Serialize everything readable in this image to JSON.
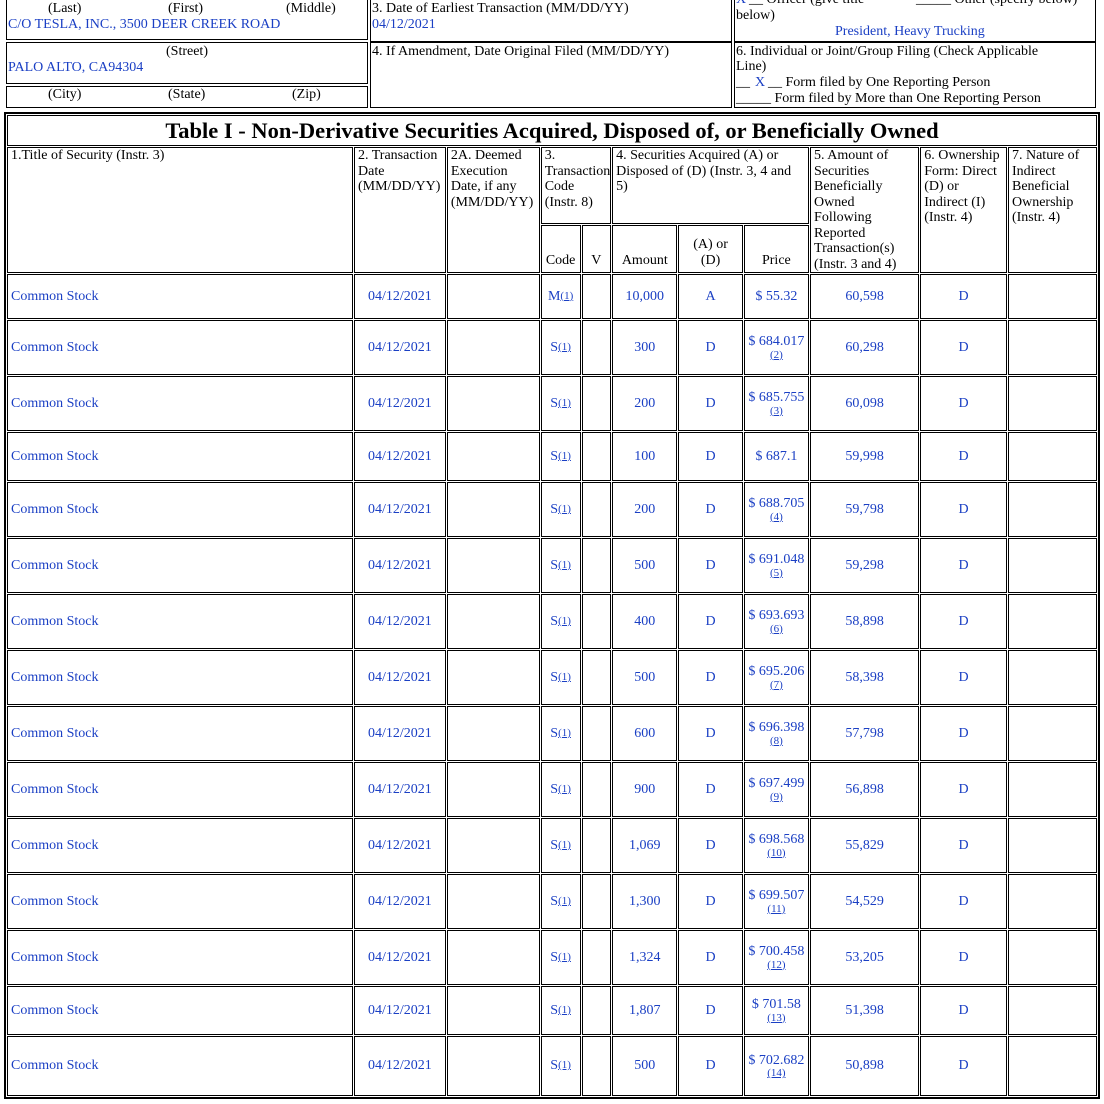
{
  "header": {
    "name_labels": {
      "last": "(Last)",
      "first": "(First)",
      "middle": "(Middle)"
    },
    "street_value": "C/O TESLA, INC., 3500 DEER CREEK ROAD",
    "street_label": "(Street)",
    "city_value": "PALO ALTO, CA94304",
    "city_label": "(City)",
    "state_label": "(State)",
    "zip_label": "(Zip)",
    "earliest_tx_label": "3. Date of Earliest Transaction (MM/DD/YY)",
    "earliest_tx_value": "04/12/2021",
    "amendment_label": "4. If Amendment, Date Original Filed (MM/DD/YY)",
    "officer_mark": "X",
    "officer_label": "__ Officer (give title",
    "officer_label2": "below)",
    "other_label": "_____ Other (specify below)",
    "officer_title": "President, Heavy Trucking",
    "filing_label": "6. Individual or Joint/Group Filing (Check Applicable",
    "filing_label2": "Line)",
    "filing_one_prefix": "__",
    "filing_one_mark": "X",
    "filing_one_text": "__ Form filed by One Reporting Person",
    "filing_more_text": "_____ Form filed by More than One Reporting Person"
  },
  "table": {
    "title": "Table I - Non-Derivative Securities Acquired, Disposed of, or Beneficially Owned",
    "columns": {
      "c1": "1.Title of Security (Instr. 3)",
      "c2": "2. Transaction Date (MM/DD/YY)",
      "c2a": "2A. Deemed Execution Date, if any (MM/DD/YY)",
      "c3": "3. Transaction Code (Instr. 8)",
      "c4": "4. Securities Acquired (A) or Disposed of (D) (Instr. 3, 4 and 5)",
      "c5": "5. Amount of Securities Beneficially Owned Following Reported Transaction(s) (Instr. 3 and 4)",
      "c6": "6. Ownership Form: Direct (D) or Indirect (I) (Instr. 4)",
      "c7": "7. Nature of Indirect Beneficial Ownership (Instr. 4)",
      "code": "Code",
      "v": "V",
      "amount": "Amount",
      "aord": "(A) or (D)",
      "price": "Price"
    },
    "rows": [
      {
        "security": "Common Stock",
        "date": "04/12/2021",
        "code": "M",
        "code_fn": "(1)",
        "amount": "10,000",
        "ad": "A",
        "price": "$ 55.32",
        "price_fn": "",
        "owned": "60,598",
        "form": "D"
      },
      {
        "security": "Common Stock",
        "date": "04/12/2021",
        "code": "S",
        "code_fn": "(1)",
        "amount": "300",
        "ad": "D",
        "price": "$ 684.017",
        "price_fn": "(2)",
        "owned": "60,298",
        "form": "D"
      },
      {
        "security": "Common Stock",
        "date": "04/12/2021",
        "code": "S",
        "code_fn": "(1)",
        "amount": "200",
        "ad": "D",
        "price": "$ 685.755",
        "price_fn": "(3)",
        "owned": "60,098",
        "form": "D"
      },
      {
        "security": "Common Stock",
        "date": "04/12/2021",
        "code": "S",
        "code_fn": "(1)",
        "amount": "100",
        "ad": "D",
        "price": "$ 687.1",
        "price_fn": "",
        "owned": "59,998",
        "form": "D"
      },
      {
        "security": "Common Stock",
        "date": "04/12/2021",
        "code": "S",
        "code_fn": "(1)",
        "amount": "200",
        "ad": "D",
        "price": "$ 688.705",
        "price_fn": "(4)",
        "owned": "59,798",
        "form": "D"
      },
      {
        "security": "Common Stock",
        "date": "04/12/2021",
        "code": "S",
        "code_fn": "(1)",
        "amount": "500",
        "ad": "D",
        "price": "$ 691.048",
        "price_fn": "(5)",
        "owned": "59,298",
        "form": "D"
      },
      {
        "security": "Common Stock",
        "date": "04/12/2021",
        "code": "S",
        "code_fn": "(1)",
        "amount": "400",
        "ad": "D",
        "price": "$ 693.693",
        "price_fn": "(6)",
        "owned": "58,898",
        "form": "D"
      },
      {
        "security": "Common Stock",
        "date": "04/12/2021",
        "code": "S",
        "code_fn": "(1)",
        "amount": "500",
        "ad": "D",
        "price": "$ 695.206",
        "price_fn": "(7)",
        "owned": "58,398",
        "form": "D"
      },
      {
        "security": "Common Stock",
        "date": "04/12/2021",
        "code": "S",
        "code_fn": "(1)",
        "amount": "600",
        "ad": "D",
        "price": "$ 696.398",
        "price_fn": "(8)",
        "owned": "57,798",
        "form": "D"
      },
      {
        "security": "Common Stock",
        "date": "04/12/2021",
        "code": "S",
        "code_fn": "(1)",
        "amount": "900",
        "ad": "D",
        "price": "$ 697.499",
        "price_fn": "(9)",
        "owned": "56,898",
        "form": "D"
      },
      {
        "security": "Common Stock",
        "date": "04/12/2021",
        "code": "S",
        "code_fn": "(1)",
        "amount": "1,069",
        "ad": "D",
        "price": "$ 698.568",
        "price_fn": "(10)",
        "owned": "55,829",
        "form": "D"
      },
      {
        "security": "Common Stock",
        "date": "04/12/2021",
        "code": "S",
        "code_fn": "(1)",
        "amount": "1,300",
        "ad": "D",
        "price": "$ 699.507",
        "price_fn": "(11)",
        "owned": "54,529",
        "form": "D"
      },
      {
        "security": "Common Stock",
        "date": "04/12/2021",
        "code": "S",
        "code_fn": "(1)",
        "amount": "1,324",
        "ad": "D",
        "price": "$ 700.458",
        "price_fn": "(12)",
        "owned": "53,205",
        "form": "D"
      },
      {
        "security": "Common Stock",
        "date": "04/12/2021",
        "code": "S",
        "code_fn": "(1)",
        "amount": "1,807",
        "ad": "D",
        "price": "$ 701.58",
        "price_fn": "(13)",
        "owned": "51,398",
        "form": "D"
      },
      {
        "security": "Common Stock",
        "date": "04/12/2021",
        "code": "S",
        "code_fn": "(1)",
        "amount": "500",
        "ad": "D",
        "price": "$ 702.682",
        "price_fn": "(14)",
        "owned": "50,898",
        "form": "D"
      }
    ]
  }
}
